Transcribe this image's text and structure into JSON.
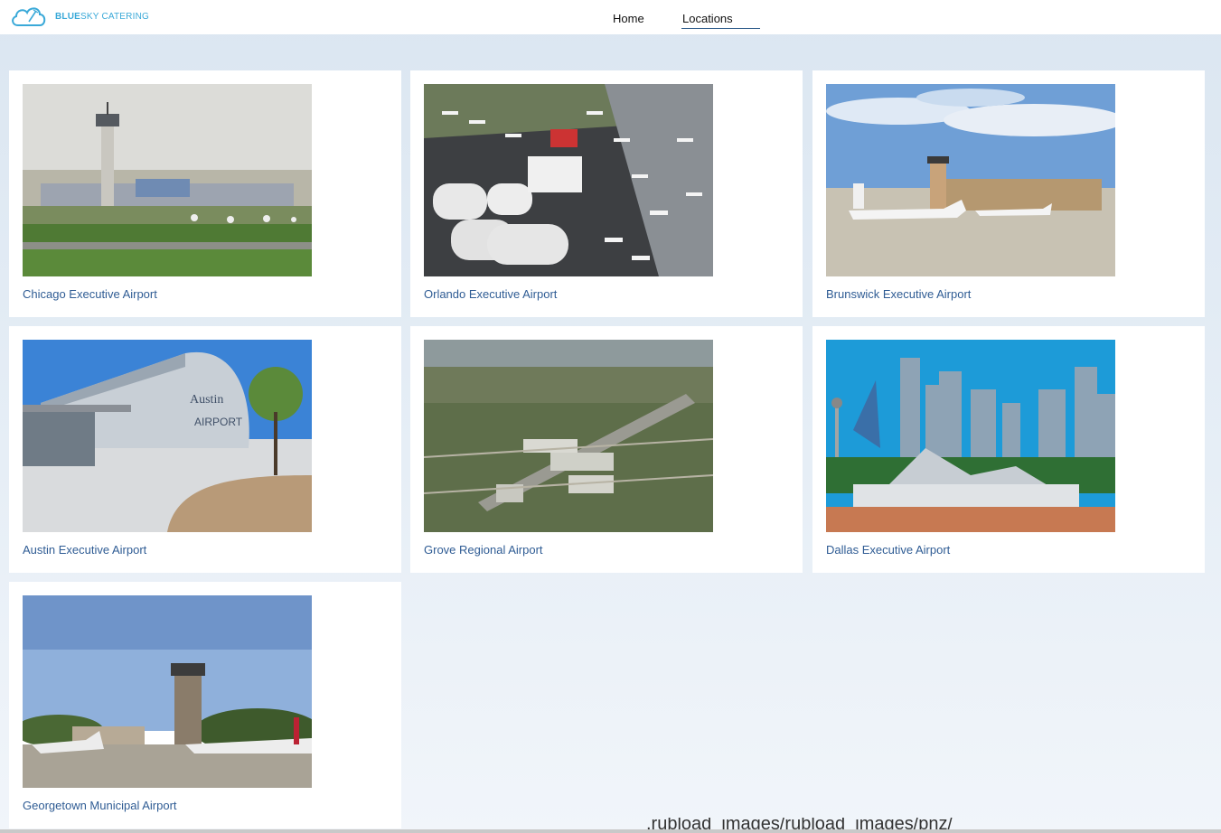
{
  "brand": {
    "bold": "BLUE",
    "rest": "SKY CATERING",
    "logo_icon": "cloud-fork-icon",
    "color": "#3aa9d8"
  },
  "nav": {
    "home": "Home",
    "locations": "Locations",
    "active": "Locations"
  },
  "locations": [
    {
      "name": "Chicago Executive Airport",
      "image": "control-tower-airfield"
    },
    {
      "name": "Orlando Executive Airport",
      "image": "aerial-airshow-jets"
    },
    {
      "name": "Brunswick Executive Airport",
      "image": "business-jets-on-ramp"
    },
    {
      "name": "Austin Executive Airport",
      "image": "terminal-hangar"
    },
    {
      "name": "Grove Regional Airport",
      "image": "aerial-runway"
    },
    {
      "name": "Dallas Executive Airport",
      "image": "city-skyline-terminal"
    },
    {
      "name": "Georgetown Municipal Airport",
      "image": "tower-with-planes"
    }
  ],
  "footer_fragment": ".rubload_images/rubload_images/pnz/",
  "colors": {
    "caption": "#2f5c94",
    "background": "#dbe6f1",
    "card": "#ffffff"
  }
}
